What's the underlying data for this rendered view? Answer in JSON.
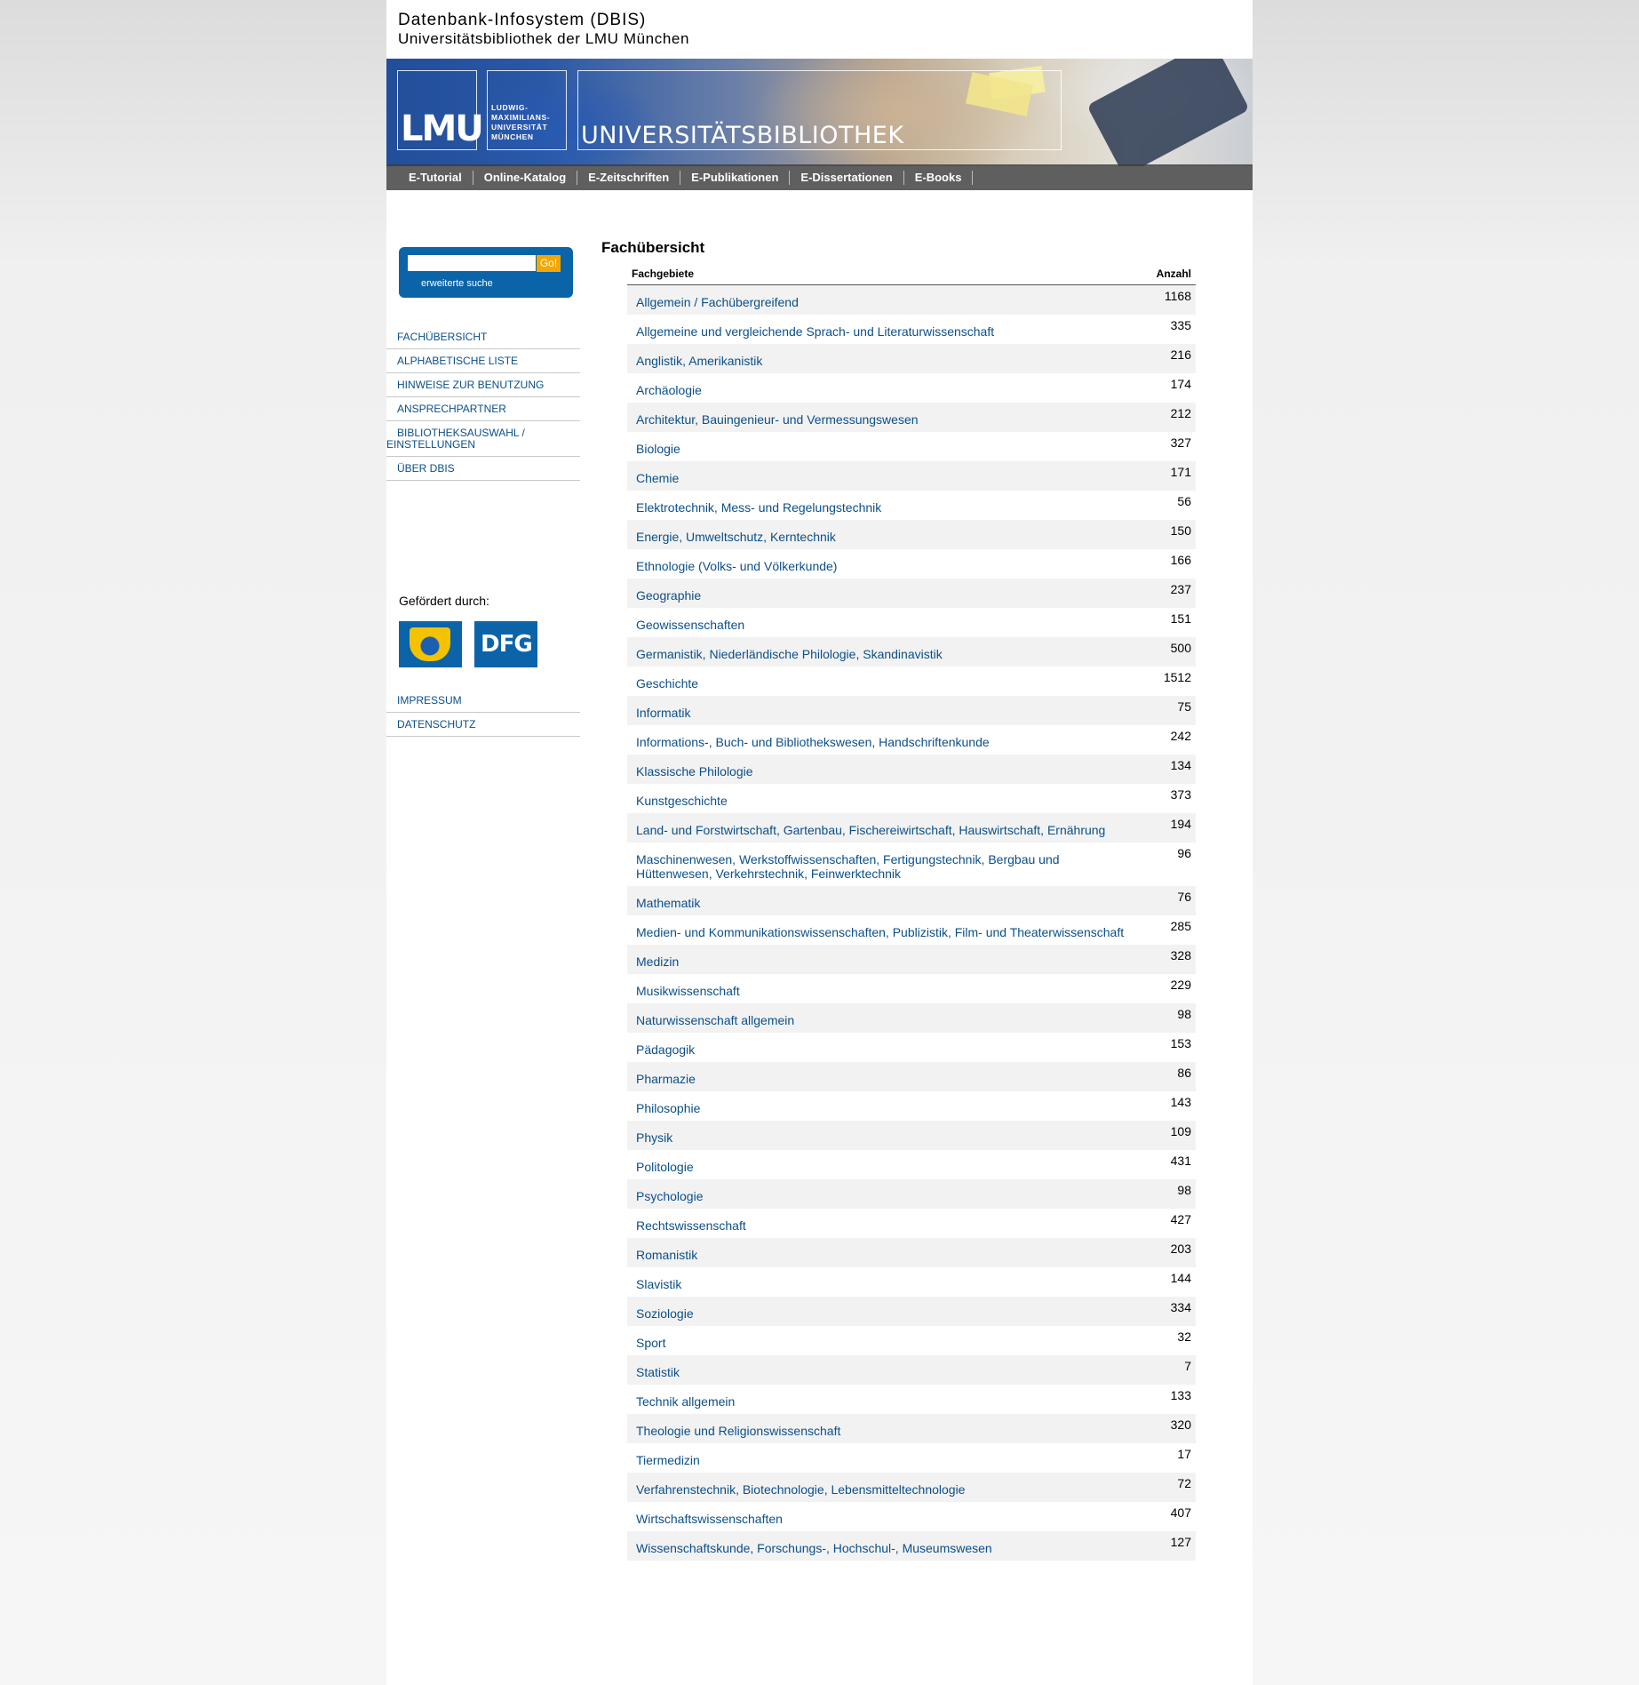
{
  "header": {
    "title": "Datenbank-Infosystem (DBIS)",
    "subtitle": "Universitätsbibliothek der LMU München"
  },
  "banner": {
    "lmu_logo": "LMU",
    "university_lines": [
      "LUDWIG-",
      "MAXIMILIANS-",
      "UNIVERSITÄT",
      "MÜNCHEN"
    ],
    "library_name": "UNIVERSITÄTSBIBLIOTHEK"
  },
  "top_nav": [
    {
      "label": "E-Tutorial"
    },
    {
      "label": "Online-Katalog"
    },
    {
      "label": "E-Zeitschriften"
    },
    {
      "label": "E-Publikationen"
    },
    {
      "label": "E-Dissertationen"
    },
    {
      "label": "E-Books"
    }
  ],
  "search": {
    "value": "",
    "placeholder": "",
    "go_label": "Go!",
    "advanced_label": "erweiterte suche"
  },
  "sidebar": {
    "items": [
      {
        "label": "FACHÜBERSICHT"
      },
      {
        "label": "ALPHABETISCHE LISTE"
      },
      {
        "label": "HINWEISE ZUR BENUTZUNG"
      },
      {
        "label": "ANSPRECHPARTNER"
      },
      {
        "label": "BIBLIOTHEKSAUSWAHL / EINSTELLUNGEN"
      },
      {
        "label": "ÜBER DBIS"
      }
    ],
    "funded_label": "Gefördert durch:",
    "funder_logos": [
      {
        "name": "bavaria-crest-icon"
      },
      {
        "name": "DFG"
      }
    ],
    "footer_items": [
      {
        "label": "IMPRESSUM"
      },
      {
        "label": "DATENSCHUTZ"
      }
    ]
  },
  "main": {
    "title": "Fachübersicht",
    "table": {
      "columns": [
        "Fachgebiete",
        "Anzahl"
      ],
      "rows": [
        {
          "subject": "Allgemein / Fachübergreifend",
          "count": "1168"
        },
        {
          "subject": "Allgemeine und vergleichende Sprach- und Literaturwissenschaft",
          "count": "335"
        },
        {
          "subject": "Anglistik, Amerikanistik",
          "count": "216"
        },
        {
          "subject": "Archäologie",
          "count": "174"
        },
        {
          "subject": "Architektur, Bauingenieur- und Vermessungswesen",
          "count": "212"
        },
        {
          "subject": "Biologie",
          "count": "327"
        },
        {
          "subject": "Chemie",
          "count": "171"
        },
        {
          "subject": "Elektrotechnik, Mess- und Regelungstechnik",
          "count": "56"
        },
        {
          "subject": "Energie, Umweltschutz, Kerntechnik",
          "count": "150"
        },
        {
          "subject": "Ethnologie (Volks- und Völkerkunde)",
          "count": "166"
        },
        {
          "subject": "Geographie",
          "count": "237"
        },
        {
          "subject": "Geowissenschaften",
          "count": "151"
        },
        {
          "subject": "Germanistik, Niederländische Philologie, Skandinavistik",
          "count": "500"
        },
        {
          "subject": "Geschichte",
          "count": "1512"
        },
        {
          "subject": "Informatik",
          "count": "75"
        },
        {
          "subject": "Informations-, Buch- und Bibliothekswesen, Handschriftenkunde",
          "count": "242"
        },
        {
          "subject": "Klassische Philologie",
          "count": "134"
        },
        {
          "subject": "Kunstgeschichte",
          "count": "373"
        },
        {
          "subject": "Land- und Forstwirtschaft, Gartenbau, Fischereiwirtschaft, Hauswirtschaft, Ernährung",
          "count": "194"
        },
        {
          "subject": "Maschinenwesen, Werkstoffwissenschaften, Fertigungstechnik, Bergbau und Hüttenwesen, Verkehrstechnik, Feinwerktechnik",
          "count": "96"
        },
        {
          "subject": "Mathematik",
          "count": "76"
        },
        {
          "subject": "Medien- und Kommunikationswissenschaften, Publizistik, Film- und Theaterwissenschaft",
          "count": "285"
        },
        {
          "subject": "Medizin",
          "count": "328"
        },
        {
          "subject": "Musikwissenschaft",
          "count": "229"
        },
        {
          "subject": "Naturwissenschaft allgemein",
          "count": "98"
        },
        {
          "subject": "Pädagogik",
          "count": "153"
        },
        {
          "subject": "Pharmazie",
          "count": "86"
        },
        {
          "subject": "Philosophie",
          "count": "143"
        },
        {
          "subject": "Physik",
          "count": "109"
        },
        {
          "subject": "Politologie",
          "count": "431"
        },
        {
          "subject": "Psychologie",
          "count": "98"
        },
        {
          "subject": "Rechtswissenschaft",
          "count": "427"
        },
        {
          "subject": "Romanistik",
          "count": "203"
        },
        {
          "subject": "Slavistik",
          "count": "144"
        },
        {
          "subject": "Soziologie",
          "count": "334"
        },
        {
          "subject": "Sport",
          "count": "32"
        },
        {
          "subject": "Statistik",
          "count": "7"
        },
        {
          "subject": "Technik allgemein",
          "count": "133"
        },
        {
          "subject": "Theologie und Religionswissenschaft",
          "count": "320"
        },
        {
          "subject": "Tiermedizin",
          "count": "17"
        },
        {
          "subject": "Verfahrenstechnik, Biotechnologie, Lebensmitteltechnologie",
          "count": "72"
        },
        {
          "subject": "Wirtschaftswissenschaften",
          "count": "407"
        },
        {
          "subject": "Wissenschaftskunde, Forschungs-, Hochschul-, Museumswesen",
          "count": "127"
        }
      ]
    }
  },
  "colors": {
    "link": "#0b4f8a",
    "search_box": "#0b63a8",
    "go_button": "#f5a600",
    "row_alt": "#f2f2f2"
  }
}
